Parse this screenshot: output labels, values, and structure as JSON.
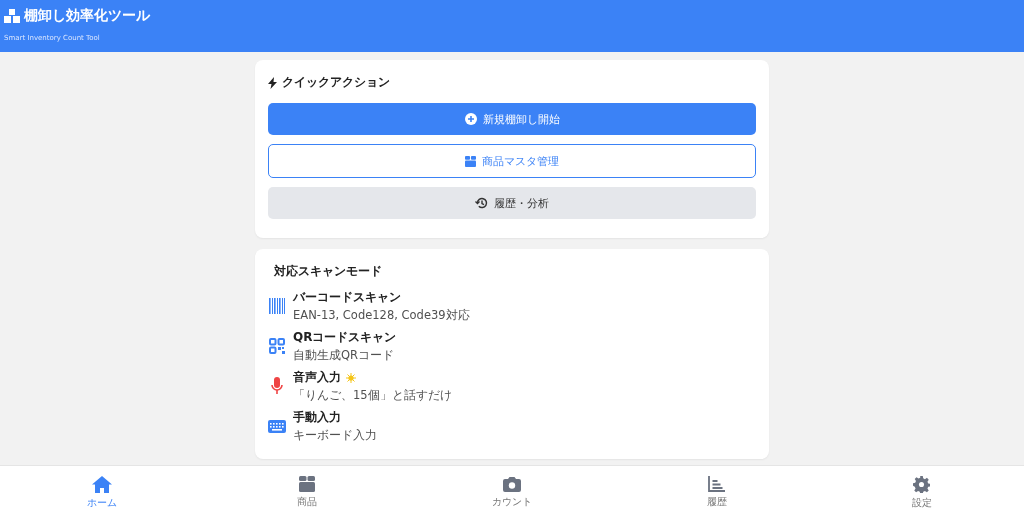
{
  "header": {
    "title": "棚卸し効率化ツール",
    "subtitle": "Smart Inventory Count Tool"
  },
  "quick_actions": {
    "title": "クイックアクション",
    "buttons": [
      {
        "label": "新規棚卸し開始",
        "kind": "primary"
      },
      {
        "label": "商品マスタ管理",
        "kind": "outline"
      },
      {
        "label": "履歴・分析",
        "kind": "secondary"
      }
    ]
  },
  "scan_modes": {
    "title": "対応スキャンモード",
    "items": [
      {
        "kind": "barcode",
        "name": "バーコードスキャン",
        "description": "EAN-13, Code128, Code39対応",
        "highlighted": false
      },
      {
        "kind": "qr",
        "name": "QRコードスキャン",
        "description": "自動生成QRコード",
        "highlighted": false
      },
      {
        "kind": "voice",
        "name": "音声入力",
        "description": "「りんご、15個」と話すだけ",
        "highlighted": true
      },
      {
        "kind": "keyboard",
        "name": "手動入力",
        "description": "キーボード入力",
        "highlighted": false
      }
    ]
  },
  "bottom_nav": [
    {
      "kind": "home",
      "label": "ホーム",
      "selected": true
    },
    {
      "kind": "box",
      "label": "商品",
      "selected": false
    },
    {
      "kind": "camera",
      "label": "カウント",
      "selected": false
    },
    {
      "kind": "chart",
      "label": "履歴",
      "selected": false
    },
    {
      "kind": "gear",
      "label": "設定",
      "selected": false
    }
  ]
}
